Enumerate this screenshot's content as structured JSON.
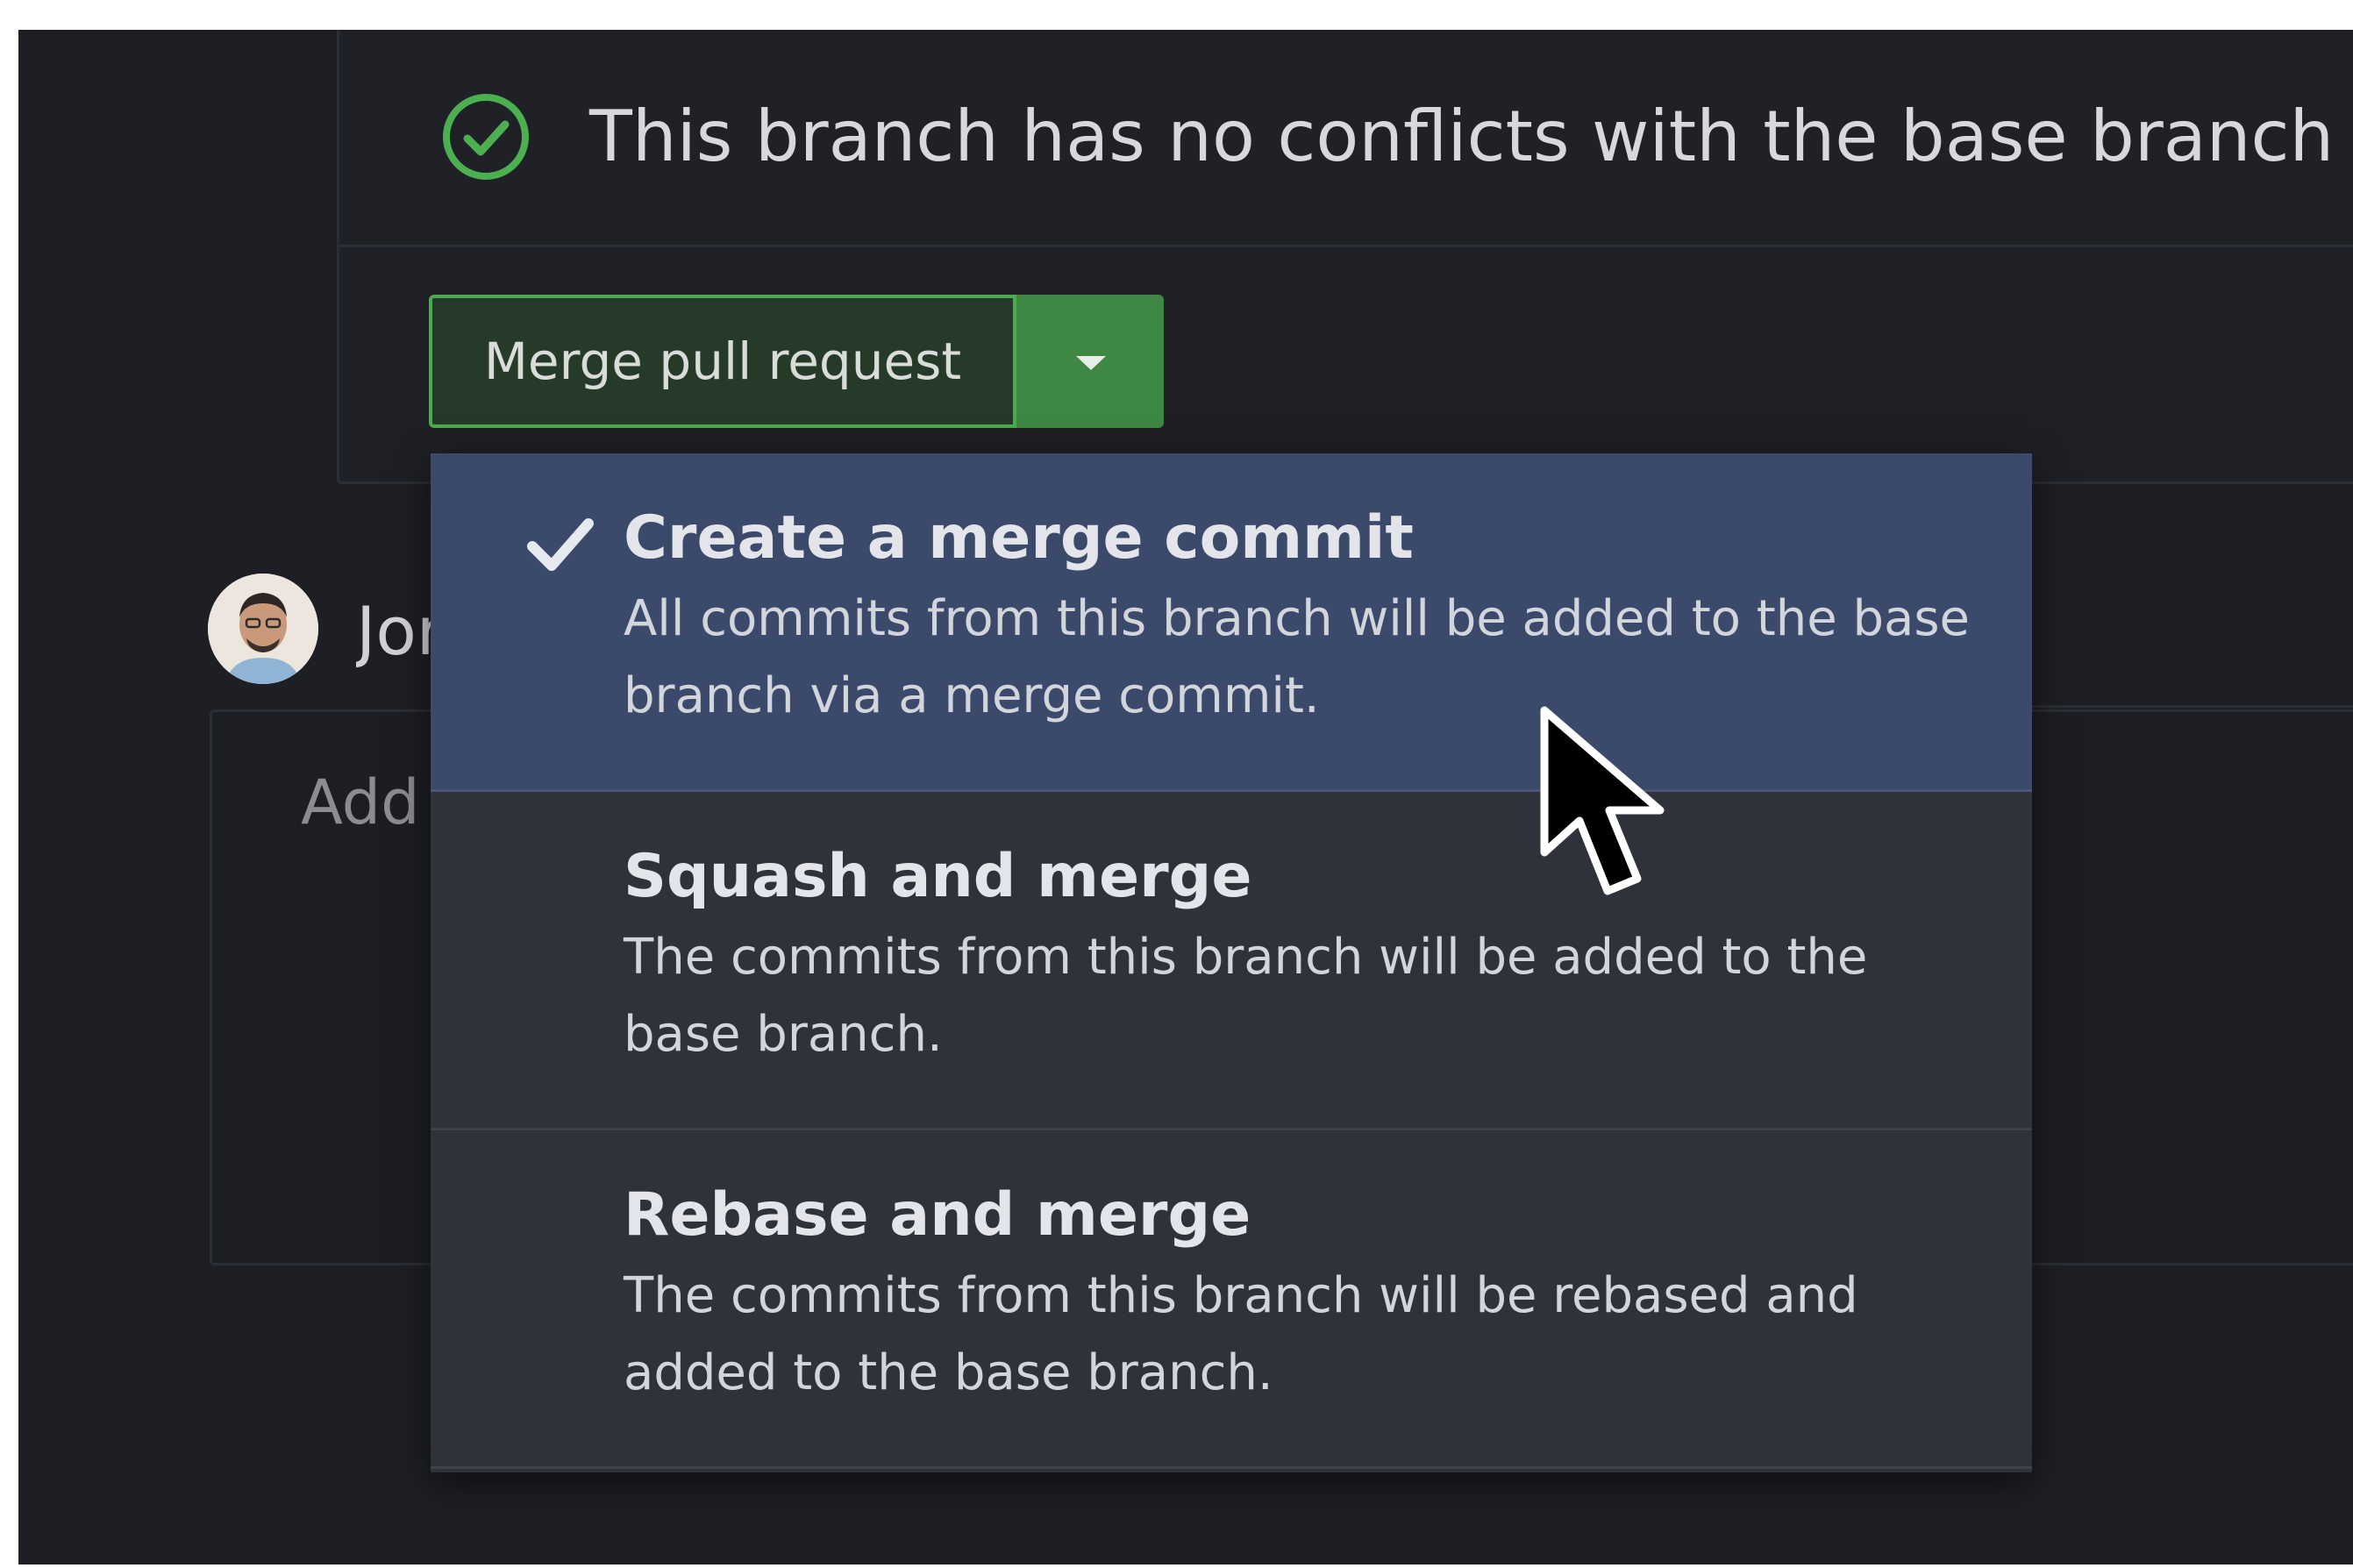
{
  "status": {
    "message": "This branch has no conflicts with the base branch",
    "icon": "check-circle-icon",
    "color": "#4caf50"
  },
  "merge_button": {
    "label": "Merge pull request",
    "caret_icon": "caret-down-icon"
  },
  "comment": {
    "author": "Jor",
    "placeholder": "Add"
  },
  "dropdown": {
    "items": [
      {
        "title": "Create a merge commit",
        "description": "All commits from this branch will be added to the base branch via a merge commit.",
        "selected": true
      },
      {
        "title": "Squash and merge",
        "description": "The commits from this branch will be added to the base branch.",
        "selected": false
      },
      {
        "title": "Rebase and merge",
        "description": "The commits from this branch will be rebased and added to the base branch.",
        "selected": false
      }
    ]
  },
  "colors": {
    "background": "#1e1f24",
    "accent_green": "#4caa4f",
    "selected_item": "#3b4a6b",
    "menu_background": "#30323b"
  }
}
